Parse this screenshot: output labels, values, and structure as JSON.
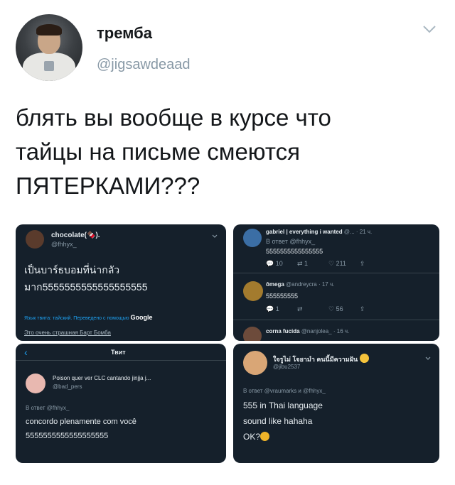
{
  "tweet": {
    "author_name": "тремба",
    "author_handle": "@jigsawdeaad",
    "text_lines": [
      "блять вы вообще в курсе что",
      "тайцы на письме смеются",
      "ПЯТЕРКАМИ???"
    ]
  },
  "panel1": {
    "user": "chocolate(🍫).",
    "handle": "@fhhyx_",
    "line1": "เป็นบาร์ธบอมที่น่ากลัว",
    "line2": "มาก5555555555555555555",
    "translate_note": "Язык твита: тайский. Переведено с помощью",
    "google": "Google",
    "translation": "Это очень страшная Барт Бомба"
  },
  "panel2": {
    "user1": "gabriel | everything i wanted",
    "meta1": "@... · 21 ч.",
    "reply_to1": "В ответ @fhhyx_",
    "text1": "5555555555555555",
    "actions1": [
      "10",
      "1",
      "211",
      ""
    ],
    "user2": "ômega",
    "meta2": "@andreycra · 17 ч.",
    "text2": "555555555",
    "actions2": [
      "1",
      "",
      "56",
      ""
    ],
    "user3": "corna fucida",
    "meta3": "@nanjolea_ · 16 ч."
  },
  "panel3": {
    "header": "Твит",
    "user": "Poison quer ver CLC cantando jinjja j...",
    "handle": "@bad_pers",
    "reply_to": "В ответ @fhhyx_",
    "text1": "concordo plenamente com você",
    "text2": "5555555555555555555"
  },
  "panel4": {
    "user": "ใจรูไม่ โจยามำ คนนี้มีความฝัน",
    "handle": "@jibu2537",
    "reply_to": "В ответ @vraumarks и @fhhyx_",
    "text1": "555 in Thai language",
    "text2": "sound like hahaha",
    "text3": "OK?"
  },
  "colors": {
    "panel_bg": "#15202b",
    "link": "#1da1f2",
    "dim": "#8899a6"
  }
}
